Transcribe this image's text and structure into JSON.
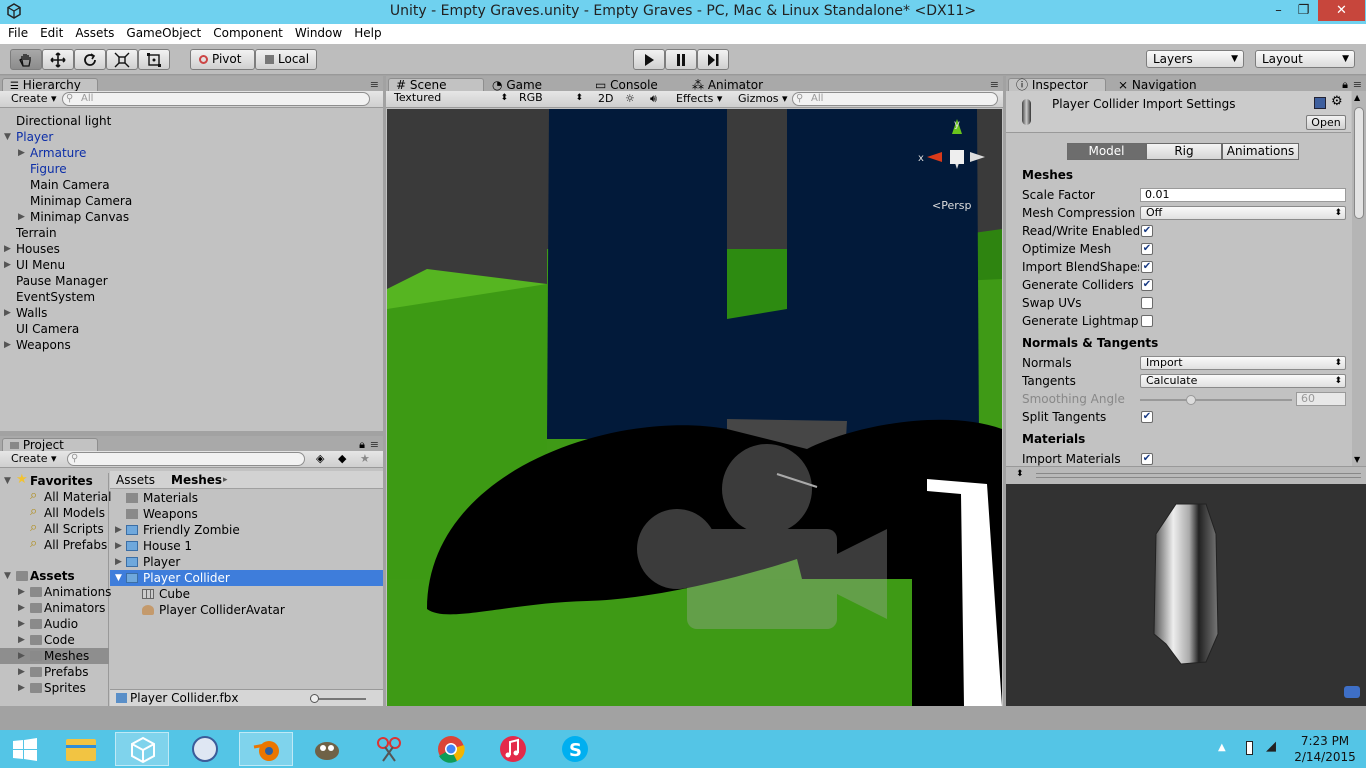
{
  "window": {
    "title": "Unity - Empty Graves.unity - Empty Graves - PC, Mac & Linux Standalone* <DX11>",
    "controls": [
      "–",
      "❐",
      "✕"
    ]
  },
  "menu": [
    "File",
    "Edit",
    "Assets",
    "GameObject",
    "Component",
    "Window",
    "Help"
  ],
  "toolbar": {
    "pivot_label": "Pivot",
    "local_label": "Local",
    "layers_label": "Layers",
    "layout_label": "Layout"
  },
  "hierarchy": {
    "tab": "Hierarchy",
    "create": "Create",
    "search_placeholder": "All",
    "items": [
      {
        "label": "Directional light",
        "indent": 0,
        "arrow": "",
        "color": "normal"
      },
      {
        "label": "Player",
        "indent": 0,
        "arrow": "▼",
        "color": "blue"
      },
      {
        "label": "Armature",
        "indent": 1,
        "arrow": "▶",
        "color": "blue"
      },
      {
        "label": "Figure",
        "indent": 1,
        "arrow": "",
        "color": "blue"
      },
      {
        "label": "Main Camera",
        "indent": 1,
        "arrow": "",
        "color": "normal"
      },
      {
        "label": "Minimap Camera",
        "indent": 1,
        "arrow": "",
        "color": "normal"
      },
      {
        "label": "Minimap Canvas",
        "indent": 1,
        "arrow": "▶",
        "color": "normal"
      },
      {
        "label": "Terrain",
        "indent": 0,
        "arrow": "",
        "color": "normal"
      },
      {
        "label": "Houses",
        "indent": 0,
        "arrow": "▶",
        "color": "normal"
      },
      {
        "label": "UI Menu",
        "indent": 0,
        "arrow": "▶",
        "color": "normal"
      },
      {
        "label": "Pause Manager",
        "indent": 0,
        "arrow": "",
        "color": "normal"
      },
      {
        "label": "EventSystem",
        "indent": 0,
        "arrow": "",
        "color": "normal"
      },
      {
        "label": "Walls",
        "indent": 0,
        "arrow": "▶",
        "color": "normal"
      },
      {
        "label": "UI Camera",
        "indent": 0,
        "arrow": "",
        "color": "normal"
      },
      {
        "label": "Weapons",
        "indent": 0,
        "arrow": "▶",
        "color": "normal"
      }
    ]
  },
  "project": {
    "tab": "Project",
    "create": "Create",
    "favorites_label": "Favorites",
    "favorites": [
      "All Material",
      "All Models",
      "All Scripts",
      "All Prefabs"
    ],
    "assets_label": "Assets",
    "asset_folders": [
      "Animations",
      "Animators",
      "Audio",
      "Code",
      "Meshes",
      "Prefabs",
      "Sprites"
    ],
    "breadcrumb": [
      "Assets",
      "▸",
      "Meshes",
      "▸"
    ],
    "files": [
      {
        "label": "Materials",
        "kind": "folder",
        "arrow": "",
        "indent": 0
      },
      {
        "label": "Weapons",
        "kind": "folder",
        "arrow": "",
        "indent": 0
      },
      {
        "label": "Friendly Zombie",
        "kind": "model",
        "arrow": "▶",
        "indent": 0
      },
      {
        "label": "House 1",
        "kind": "model",
        "arrow": "▶",
        "indent": 0
      },
      {
        "label": "Player",
        "kind": "model",
        "arrow": "▶",
        "indent": 0
      },
      {
        "label": "Player Collider",
        "kind": "model",
        "arrow": "▼",
        "indent": 0
      },
      {
        "label": "Cube",
        "kind": "mesh",
        "arrow": "",
        "indent": 1
      },
      {
        "label": "Player ColliderAvatar",
        "kind": "avatar",
        "arrow": "",
        "indent": 1
      }
    ],
    "status_file": "Player Collider.fbx"
  },
  "scene": {
    "tabs": [
      "Scene",
      "Game",
      "Console",
      "Animator"
    ],
    "textured": "Textured",
    "rgb": "RGB",
    "mode2d": "2D",
    "effects": "Effects",
    "gizmos": "Gizmos",
    "search_placeholder": "All",
    "gizmo_y": "y",
    "gizmo_x": "x",
    "persp": "Persp"
  },
  "inspector": {
    "tabs": [
      "Inspector",
      "Navigation"
    ],
    "title": "Player Collider Import Settings",
    "open_button": "Open",
    "segments": [
      "Model",
      "Rig",
      "Animations"
    ],
    "meshes_header": "Meshes",
    "scale_factor_label": "Scale Factor",
    "scale_factor_value": "0.01",
    "mesh_compression_label": "Mesh Compression",
    "mesh_compression_value": "Off",
    "checks": [
      {
        "label": "Read/Write Enabled",
        "checked": true
      },
      {
        "label": "Optimize Mesh",
        "checked": true
      },
      {
        "label": "Import BlendShapes",
        "checked": true
      },
      {
        "label": "Generate Colliders",
        "checked": true
      },
      {
        "label": "Swap UVs",
        "checked": false
      },
      {
        "label": "Generate Lightmap UVs",
        "checked": false
      }
    ],
    "normals_header": "Normals & Tangents",
    "normals_label": "Normals",
    "normals_value": "Import",
    "tangents_label": "Tangents",
    "tangents_value": "Calculate",
    "smoothing_label": "Smoothing Angle",
    "smoothing_value": "60",
    "split_tangents_label": "Split Tangents",
    "materials_header": "Materials",
    "import_materials_label": "Import Materials"
  },
  "taskbar": {
    "time": "7:23 PM",
    "date": "2/14/2015"
  },
  "colors": {
    "titlebar": "#6fd1ef",
    "selection": "#3e7ddb",
    "taskbar": "#54c5e6"
  }
}
